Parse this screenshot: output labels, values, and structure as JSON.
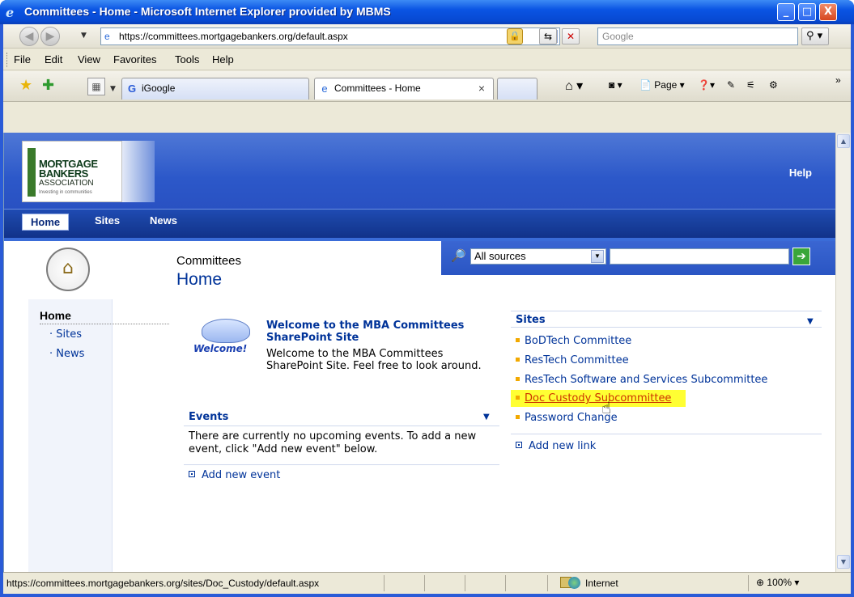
{
  "window": {
    "title": "Committees - Home - Microsoft Internet Explorer provided by MBMS",
    "minimize": "_",
    "maximize": "□",
    "close": "X"
  },
  "addressbar": {
    "url": "https://committees.mortgagebankers.org/default.aspx",
    "search_placeholder": "Google"
  },
  "menu": {
    "items": [
      "File",
      "Edit",
      "View",
      "Favorites",
      "Tools",
      "Help"
    ]
  },
  "tabs": [
    {
      "label": "iGoogle",
      "active": false
    },
    {
      "label": "Committees - Home",
      "active": true
    }
  ],
  "toolbar": {
    "page_label": "Page"
  },
  "sharepoint": {
    "logo": {
      "line1": "MORTGAGE",
      "line2": "BANKERS",
      "line3": "ASSOCIATION",
      "tagline": "Investing in communities"
    },
    "help": "Help",
    "nav": [
      "Home",
      "Sites",
      "News"
    ],
    "breadcrumb": "Committees",
    "page_title": "Home",
    "search_scope": "All sources",
    "left_nav": {
      "heading": "Home",
      "items": [
        "Sites",
        "News"
      ]
    },
    "welcome": {
      "heading": "Welcome to the MBA Committees SharePoint Site",
      "body": "Welcome to the MBA Committees SharePoint Site. Feel free to look around.",
      "image_word": "Welcome!"
    },
    "events": {
      "title": "Events",
      "body": "There are currently no upcoming events. To add a new event, click \"Add new event\" below.",
      "add_link": "Add new event"
    },
    "sites": {
      "title": "Sites",
      "items": [
        "BoDTech Committee",
        "ResTech Committee",
        "ResTech Software and Services Subcommittee",
        "Doc Custody Subcommittee",
        "Password Change"
      ],
      "highlighted_index": 3,
      "add_link": "Add new link"
    }
  },
  "statusbar": {
    "url": "https://committees.mortgagebankers.org/sites/Doc_Custody/default.aspx",
    "zone": "Internet",
    "zoom": "100%"
  }
}
